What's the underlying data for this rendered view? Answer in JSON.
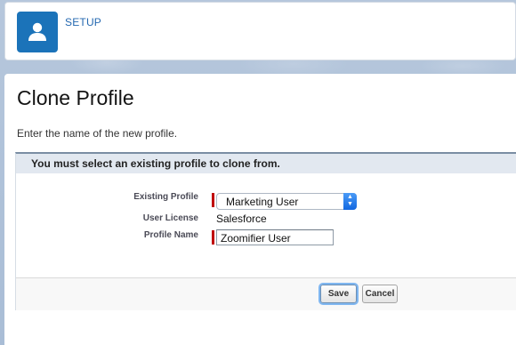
{
  "header": {
    "section_label": "SETUP",
    "avatar_icon": "user-icon"
  },
  "page": {
    "title": "Clone Profile",
    "description": "Enter the name of the new profile."
  },
  "form": {
    "message": "You must select an existing profile to clone from.",
    "existing_profile": {
      "label": "Existing Profile",
      "value": "Marketing User"
    },
    "user_license": {
      "label": "User License",
      "value": "Salesforce"
    },
    "profile_name": {
      "label": "Profile Name",
      "value": "Zoomifier User"
    },
    "save_label": "Save",
    "cancel_label": "Cancel"
  },
  "colors": {
    "brand_blue": "#1b73b9",
    "link_blue": "#2468b0",
    "required_red": "#c00000"
  }
}
